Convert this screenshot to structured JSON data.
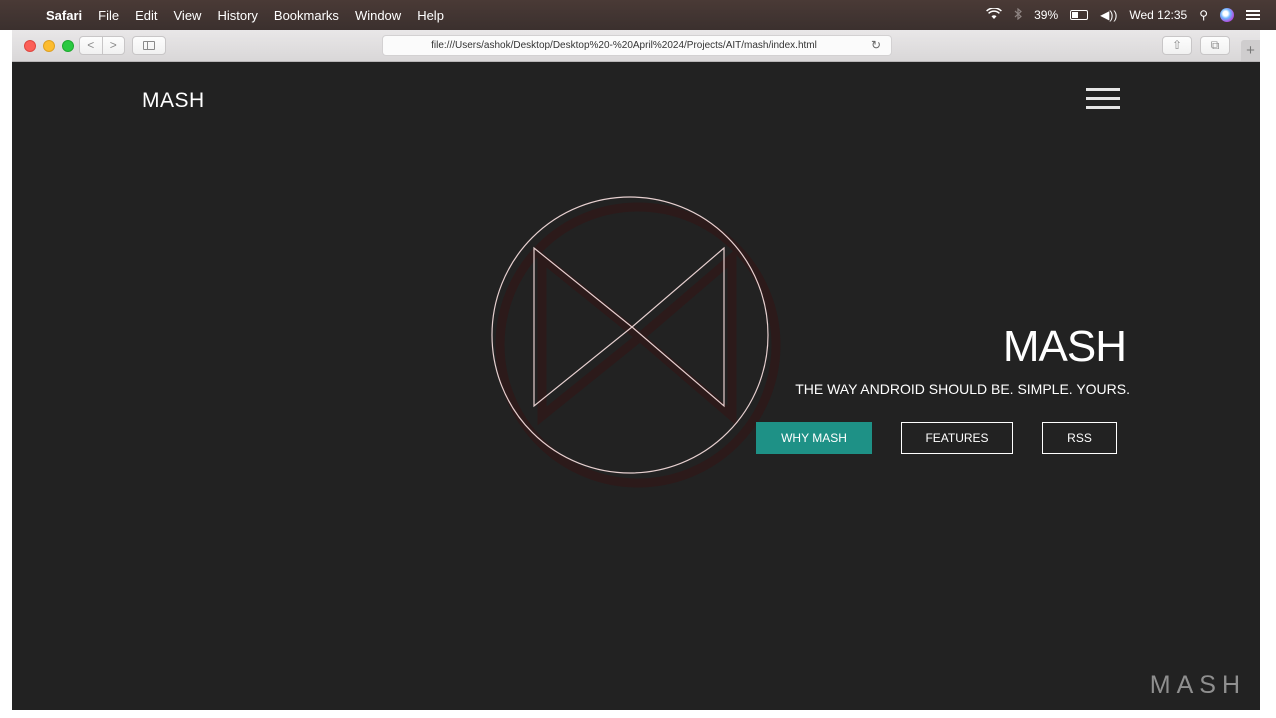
{
  "menubar": {
    "apple_glyph": "",
    "app_name": "Safari",
    "menus": [
      "File",
      "Edit",
      "View",
      "History",
      "Bookmarks",
      "Window",
      "Help"
    ],
    "status": {
      "wifi_icon": "wifi-icon",
      "bluetooth_icon": "bluetooth-icon",
      "battery": "39%",
      "volume_glyph": "◀))",
      "clock": "Wed 12:35",
      "search_glyph": "⚲"
    }
  },
  "toolbar": {
    "back_glyph": "<",
    "forward_glyph": ">",
    "url": "file:///Users/ashok/Desktop/Desktop%20-%20April%2024/Projects/AIT/mash/index.html",
    "reload_glyph": "↻",
    "share_glyph": "⇧",
    "tabs_glyph": "⧉",
    "new_tab_glyph": "+"
  },
  "page": {
    "brand": "MASH",
    "hero_title": "MASH",
    "tagline": "THE WAY ANDROID SHOULD BE. SIMPLE. YOURS.",
    "buttons": {
      "why": "WHY MASH",
      "features": "FEATURES",
      "rss": "RSS"
    },
    "watermark": "MASH",
    "colors": {
      "background": "#222222",
      "accent": "#1e9186",
      "logo_line": "#e6cfcf",
      "logo_shadow": "#2e1a1a"
    }
  }
}
